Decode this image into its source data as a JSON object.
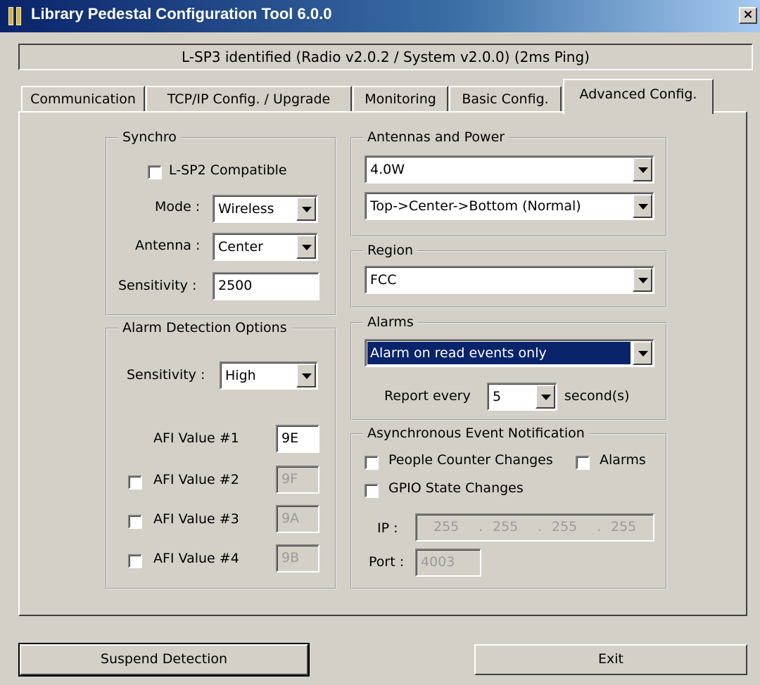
{
  "window": {
    "title": "Library Pedestal Configuration Tool 6.0.0",
    "close_label": "×"
  },
  "status": "L-SP3 identified (Radio v2.0.2 / System v2.0.0) (2ms Ping)",
  "tabs": [
    {
      "label": "Communication"
    },
    {
      "label": "TCP/IP Config. / Upgrade"
    },
    {
      "label": "Monitoring"
    },
    {
      "label": "Basic Config."
    },
    {
      "label": "Advanced Config.",
      "active": true
    }
  ],
  "synchro": {
    "legend": "Synchro",
    "compat_label": "L-SP2 Compatible",
    "mode_label": "Mode :",
    "mode_value": "Wireless",
    "antenna_label": "Antenna :",
    "antenna_value": "Center",
    "sensitivity_label": "Sensitivity :",
    "sensitivity_value": "2500"
  },
  "alarm_detection": {
    "legend": "Alarm Detection Options",
    "sensitivity_label": "Sensitivity :",
    "sensitivity_value": "High",
    "afi": [
      {
        "label": "AFI Value #1",
        "value": "9E",
        "enabled": true
      },
      {
        "label": "AFI Value #2",
        "value": "9F",
        "enabled": false
      },
      {
        "label": "AFI Value #3",
        "value": "9A",
        "enabled": false
      },
      {
        "label": "AFI Value #4",
        "value": "9B",
        "enabled": false
      }
    ]
  },
  "antennas_power": {
    "legend": "Antennas and Power",
    "power": "4.0W",
    "sequence": "Top->Center->Bottom (Normal)"
  },
  "region": {
    "legend": "Region",
    "value": "FCC"
  },
  "alarms": {
    "legend": "Alarms",
    "value": "Alarm on read events only",
    "report_label": "Report every",
    "report_value": "5",
    "unit": "second(s)"
  },
  "async": {
    "legend": "Asynchronous Event Notification",
    "people_counter": "People Counter Changes",
    "alarms": "Alarms",
    "gpio": "GPIO State Changes",
    "ip_label": "IP :",
    "ip": [
      "255",
      "255",
      "255",
      "255"
    ],
    "port_label": "Port :",
    "port": "4003"
  },
  "buttons": {
    "suspend": "Suspend Detection",
    "exit": "Exit"
  },
  "colors": {
    "titlebar": "#0a246a",
    "face": "#d4d0c8",
    "selection": "#0a246a"
  }
}
